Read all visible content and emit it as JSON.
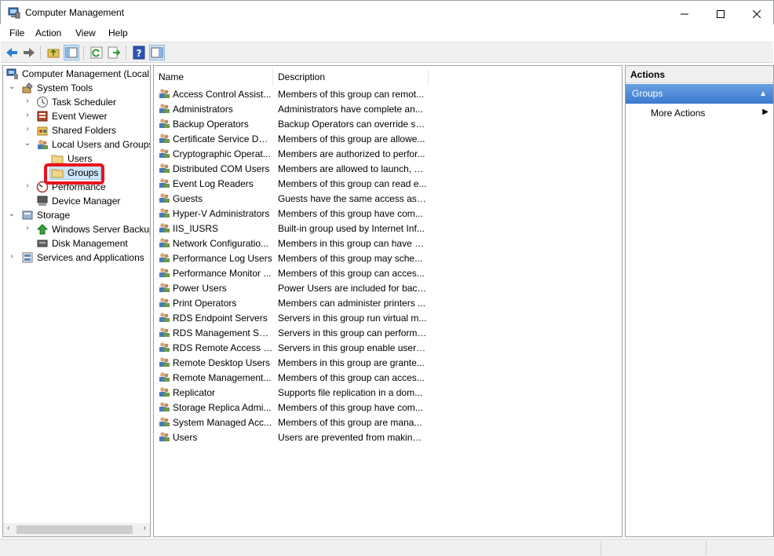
{
  "window": {
    "title": "Computer Management"
  },
  "menu": [
    "File",
    "Action",
    "View",
    "Help"
  ],
  "toolbar": {
    "icons": [
      "back-icon",
      "forward-icon",
      "up-folder-icon",
      "show-hide-console-tree-icon",
      "refresh-icon",
      "export-list-icon",
      "help-icon",
      "show-hide-action-pane-icon"
    ]
  },
  "tree": {
    "root": "Computer Management (Local",
    "system_tools": "System Tools",
    "task_scheduler": "Task Scheduler",
    "event_viewer": "Event Viewer",
    "shared_folders": "Shared Folders",
    "local_users_groups": "Local Users and Groups",
    "users": "Users",
    "groups": "Groups",
    "performance": "Performance",
    "device_manager": "Device Manager",
    "storage": "Storage",
    "windows_server_backup": "Windows Server Backup",
    "disk_management": "Disk Management",
    "services_apps": "Services and Applications"
  },
  "list": {
    "columns": [
      "Name",
      "Description"
    ],
    "rows": [
      {
        "name": "Access Control Assist...",
        "desc": "Members of this group can remot..."
      },
      {
        "name": "Administrators",
        "desc": "Administrators have complete an..."
      },
      {
        "name": "Backup Operators",
        "desc": "Backup Operators can override se..."
      },
      {
        "name": "Certificate Service DC...",
        "desc": "Members of this group are allowe..."
      },
      {
        "name": "Cryptographic Operat...",
        "desc": "Members are authorized to perfor..."
      },
      {
        "name": "Distributed COM Users",
        "desc": "Members are allowed to launch, a..."
      },
      {
        "name": "Event Log Readers",
        "desc": "Members of this group can read e..."
      },
      {
        "name": "Guests",
        "desc": "Guests have the same access as m..."
      },
      {
        "name": "Hyper-V Administrators",
        "desc": "Members of this group have com..."
      },
      {
        "name": "IIS_IUSRS",
        "desc": "Built-in group used by Internet Inf..."
      },
      {
        "name": "Network Configuratio...",
        "desc": "Members in this group can have s..."
      },
      {
        "name": "Performance Log Users",
        "desc": "Members of this group may sche..."
      },
      {
        "name": "Performance Monitor ...",
        "desc": "Members of this group can acces..."
      },
      {
        "name": "Power Users",
        "desc": "Power Users are included for back..."
      },
      {
        "name": "Print Operators",
        "desc": "Members can administer printers ..."
      },
      {
        "name": "RDS Endpoint Servers",
        "desc": "Servers in this group run virtual m..."
      },
      {
        "name": "RDS Management Ser...",
        "desc": "Servers in this group can perform ..."
      },
      {
        "name": "RDS Remote Access S...",
        "desc": "Servers in this group enable users ..."
      },
      {
        "name": "Remote Desktop Users",
        "desc": "Members in this group are grante..."
      },
      {
        "name": "Remote Management...",
        "desc": "Members of this group can acces..."
      },
      {
        "name": "Replicator",
        "desc": "Supports file replication in a dom..."
      },
      {
        "name": "Storage Replica Admi...",
        "desc": "Members of this group have com..."
      },
      {
        "name": "System Managed Acc...",
        "desc": "Members of this group are mana..."
      },
      {
        "name": "Users",
        "desc": "Users are prevented from making ..."
      }
    ]
  },
  "actions": {
    "header": "Actions",
    "section": "Groups",
    "more_actions": "More Actions"
  },
  "colors": {
    "highlight": "#e8141d",
    "action_section": "#3a79cf"
  }
}
